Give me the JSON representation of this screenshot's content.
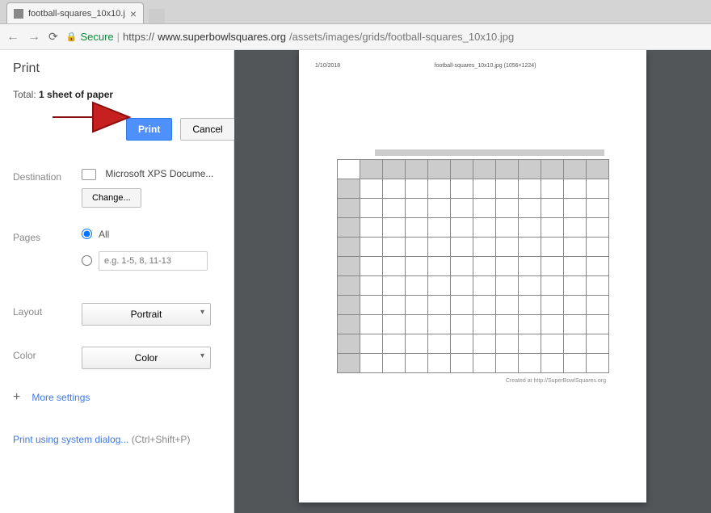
{
  "browser": {
    "tab_title": "football-squares_10x10.j",
    "secure_label": "Secure",
    "url_prefix": "https://",
    "url_domain": "www.superbowlsquares.org",
    "url_path": "/assets/images/grids/football-squares_10x10.jpg"
  },
  "print": {
    "title": "Print",
    "total_label": "Total:",
    "total_value": "1 sheet of paper",
    "print_btn": "Print",
    "cancel_btn": "Cancel",
    "destination": {
      "label": "Destination",
      "value": "Microsoft XPS Docume...",
      "change": "Change..."
    },
    "pages": {
      "label": "Pages",
      "all": "All",
      "placeholder": "e.g. 1-5, 8, 11-13"
    },
    "layout": {
      "label": "Layout",
      "value": "Portrait"
    },
    "color": {
      "label": "Color",
      "value": "Color"
    },
    "more_settings": "More settings",
    "system_dialog": "Print using system dialog...",
    "shortcut": "(Ctrl+Shift+P)"
  },
  "preview": {
    "header_left": "1/10/2018",
    "header_center": "football-squares_10x10.jpg (1056×1224)",
    "created_by": "Created at http://SuperBowlSquares.org"
  }
}
